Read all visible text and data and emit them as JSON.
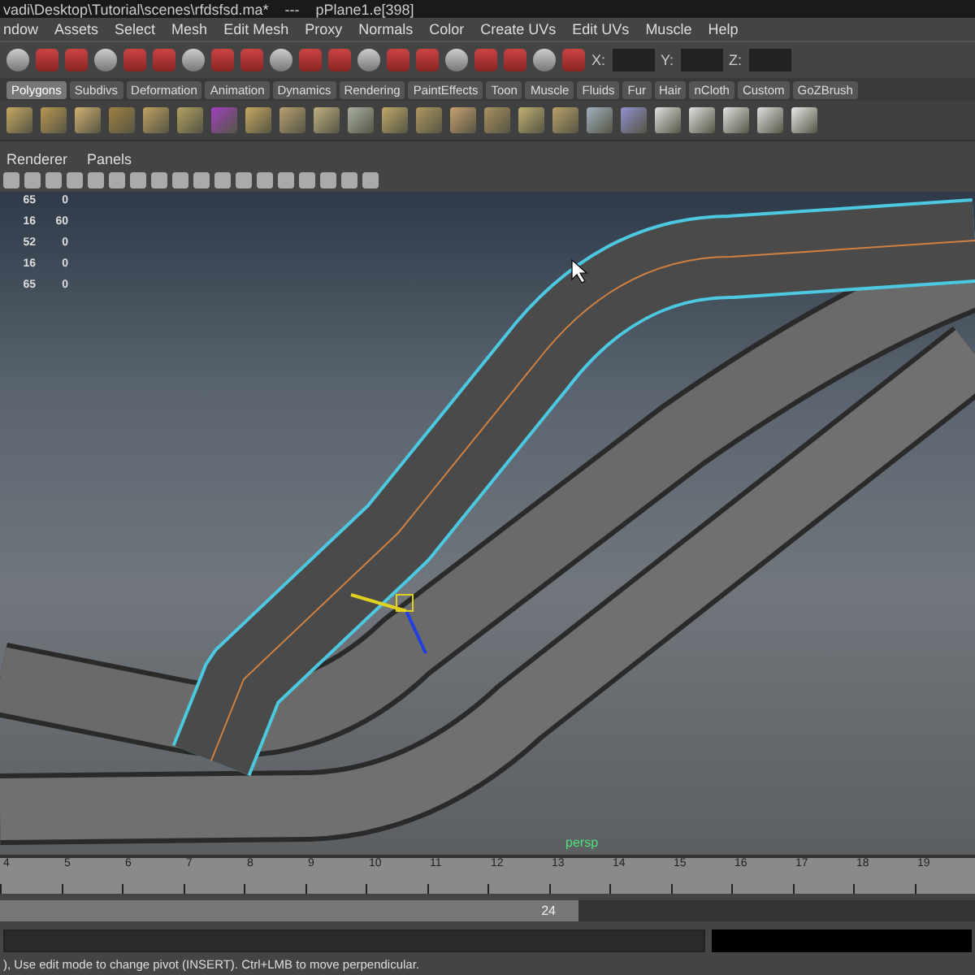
{
  "window": {
    "title": "vadi\\Desktop\\Tutorial\\scenes\\rfdsfsd.ma*",
    "separator": "---",
    "selection": "pPlane1.e[398]"
  },
  "menu_bar": [
    "ndow",
    "Assets",
    "Select",
    "Mesh",
    "Edit Mesh",
    "Proxy",
    "Normals",
    "Color",
    "Create UVs",
    "Edit UVs",
    "Muscle",
    "Help"
  ],
  "status_line": {
    "fields": [
      {
        "label": "X:"
      },
      {
        "label": "Y:"
      },
      {
        "label": "Z:"
      }
    ]
  },
  "shelf_tabs": [
    {
      "label": "Polygons",
      "selected": true
    },
    {
      "label": "Subdivs",
      "selected": false
    },
    {
      "label": "Deformation",
      "selected": false
    },
    {
      "label": "Animation",
      "selected": false
    },
    {
      "label": "Dynamics",
      "selected": false
    },
    {
      "label": "Rendering",
      "selected": false
    },
    {
      "label": "PaintEffects",
      "selected": false
    },
    {
      "label": "Toon",
      "selected": false
    },
    {
      "label": "Muscle",
      "selected": false
    },
    {
      "label": "Fluids",
      "selected": false
    },
    {
      "label": "Fur",
      "selected": false
    },
    {
      "label": "Hair",
      "selected": false
    },
    {
      "label": "nCloth",
      "selected": false
    },
    {
      "label": "Custom",
      "selected": false
    },
    {
      "label": "GoZBrush",
      "selected": false
    }
  ],
  "panel_menu": [
    "Renderer",
    "Panels"
  ],
  "viewport": {
    "camera": "persp",
    "stats": [
      [
        "65",
        "0"
      ],
      [
        "16",
        "60"
      ],
      [
        "52",
        "0"
      ],
      [
        "16",
        "0"
      ],
      [
        "65",
        "0"
      ]
    ]
  },
  "time_slider": {
    "ticks": [
      "4",
      "5",
      "6",
      "7",
      "8",
      "9",
      "10",
      "11",
      "12",
      "13",
      "14",
      "15",
      "16",
      "17",
      "18",
      "19"
    ]
  },
  "range_slider": {
    "end": "24",
    "level": 0.57
  },
  "help_line": "), Use edit mode to change pivot (INSERT).  Ctrl+LMB to move perpendicular."
}
